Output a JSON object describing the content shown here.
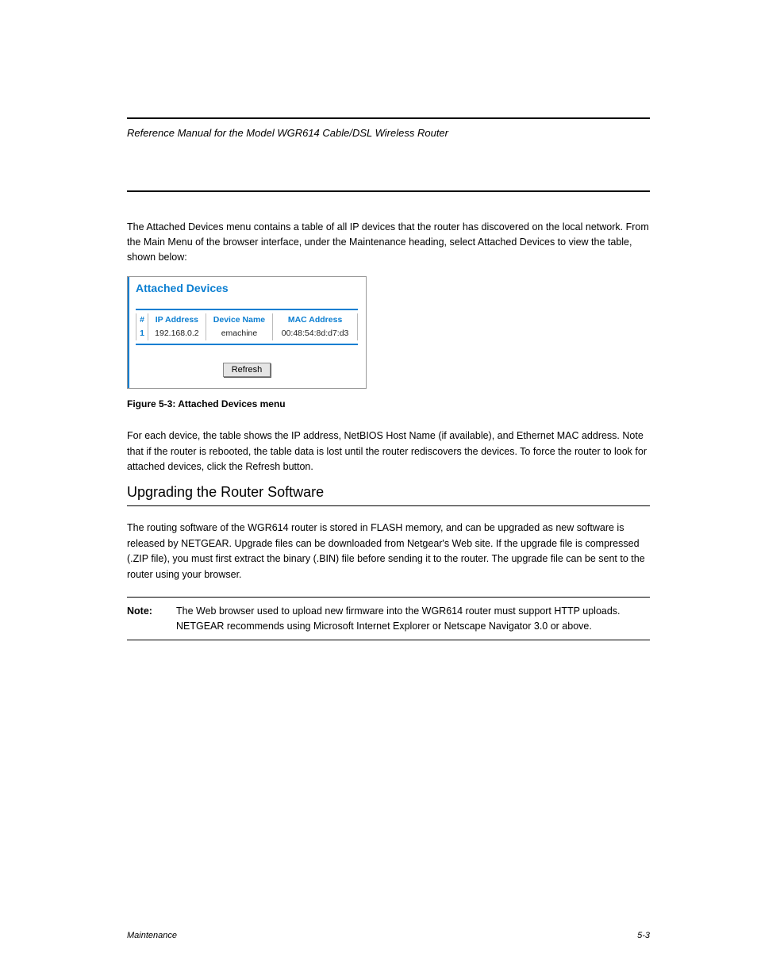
{
  "chapter_header": {
    "left": "Reference Manual for the Model WGR614 Cable/DSL Wireless Router",
    "right": ""
  },
  "intro_text": "The Attached Devices menu contains a table of all IP devices that the router has discovered on the local network. From the Main Menu of the browser interface, under the Maintenance heading, select Attached Devices to view the table, shown below:",
  "panel": {
    "title": "Attached Devices",
    "headers": [
      "#",
      "IP Address",
      "Device Name",
      "MAC Address"
    ],
    "rows": [
      {
        "num": "1",
        "ip": "192.168.0.2",
        "name": "emachine",
        "mac": "00:48:54:8d:d7:d3"
      }
    ],
    "refresh_label": "Refresh"
  },
  "figure_label": "Figure 5-3:  Attached Devices menu",
  "para_intro": "For each device, the table shows the IP address, NetBIOS Host Name (if available), and Ethernet MAC address. Note that if the router is rebooted, the table data is lost until the router rediscovers the devices. To force the router to look for attached devices, click the Refresh button.",
  "section_h2": "Upgrading the Router Software",
  "section_body": "The routing software of the WGR614 router is stored in FLASH memory, and can be upgraded as new software is released by NETGEAR. Upgrade files can be downloaded from Netgear's Web site. If the upgrade file is compressed (.ZIP file), you must first extract the binary (.BIN) file before sending it to the router. The upgrade file can be sent to the router using your browser.",
  "note": {
    "label": "Note:",
    "text": "The Web browser used to upload new firmware into the WGR614 router must support HTTP uploads. NETGEAR recommends using Microsoft Internet Explorer or Netscape Navigator 3.0 or above."
  },
  "footer": {
    "left": "Maintenance",
    "right": "5-3"
  }
}
